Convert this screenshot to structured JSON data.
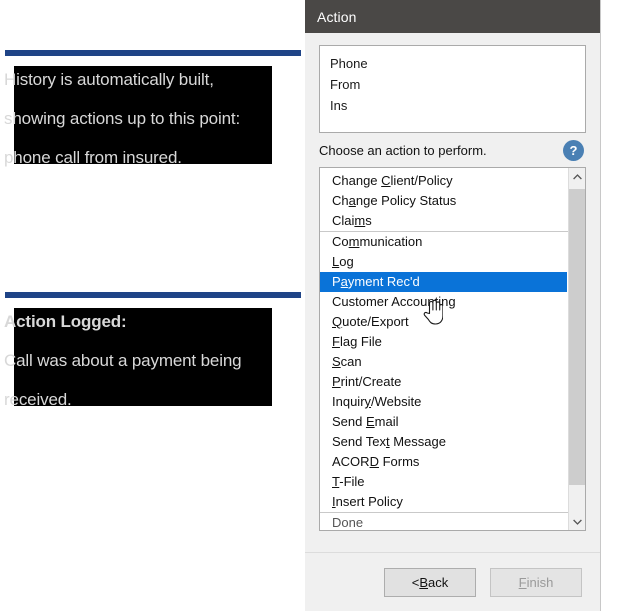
{
  "annotations": {
    "blocks": [
      {
        "lines": [
          {
            "text": "History is automatically built,",
            "bold": false
          },
          {
            "text": "showing actions up to this point:",
            "bold": false
          },
          {
            "text": "phone call from insured.",
            "bold": false
          }
        ]
      },
      {
        "lines": [
          {
            "text": "Action Logged:",
            "bold": true
          },
          {
            "text": "Call was about a payment being",
            "bold": false
          },
          {
            "text": "received.",
            "bold": false
          }
        ]
      }
    ],
    "rule_color": "#1f4487",
    "redaction_color": "#000000",
    "text_color": "#d8d8d8"
  },
  "dialog": {
    "title": "Action",
    "titlebar_color": "#4a4846",
    "history": {
      "lines": [
        "Phone",
        "From",
        "Ins"
      ]
    },
    "prompt": "Choose an action to perform.",
    "help_icon": "question-mark-circle-icon",
    "help_icon_color": "#4a80b4",
    "selection_color": "#0a73d8",
    "list": [
      {
        "label": "Change Client/Policy",
        "mnemonic": "C",
        "mnemonic_index": 7,
        "selected": false,
        "separator_after": false
      },
      {
        "label": "Change Policy Status",
        "mnemonic": "a",
        "mnemonic_index": 2,
        "selected": false,
        "separator_after": false
      },
      {
        "label": "Claims",
        "mnemonic": "m",
        "mnemonic_index": 4,
        "selected": false,
        "separator_after": true
      },
      {
        "label": "Communication",
        "mnemonic": "o",
        "mnemonic_index": 2,
        "selected": false,
        "separator_after": false
      },
      {
        "label": "Log",
        "mnemonic": "L",
        "mnemonic_index": 0,
        "selected": false,
        "separator_after": false
      },
      {
        "label": "Payment Rec'd",
        "mnemonic": "a",
        "mnemonic_index": 1,
        "selected": true,
        "separator_after": false
      },
      {
        "label": "Customer Accounting",
        "mnemonic": "n",
        "mnemonic_index": 15,
        "selected": false,
        "separator_after": false
      },
      {
        "label": "Quote/Export",
        "mnemonic": "Q",
        "mnemonic_index": 0,
        "selected": false,
        "separator_after": false
      },
      {
        "label": "Flag File",
        "mnemonic": "F",
        "mnemonic_index": 0,
        "selected": false,
        "separator_after": false
      },
      {
        "label": "Scan",
        "mnemonic": "S",
        "mnemonic_index": 0,
        "selected": false,
        "separator_after": false
      },
      {
        "label": "Print/Create",
        "mnemonic": "P",
        "mnemonic_index": 0,
        "selected": false,
        "separator_after": false
      },
      {
        "label": "Inquiry/Website",
        "mnemonic": "y",
        "mnemonic_index": 6,
        "selected": false,
        "separator_after": false
      },
      {
        "label": "Send Email",
        "mnemonic": "E",
        "mnemonic_index": 5,
        "selected": false,
        "separator_after": false
      },
      {
        "label": "Send Text Message",
        "mnemonic": "x",
        "mnemonic_index": 8,
        "selected": false,
        "separator_after": false
      },
      {
        "label": "ACORD Forms",
        "mnemonic": "D",
        "mnemonic_index": 4,
        "selected": false,
        "separator_after": false
      },
      {
        "label": "T-File",
        "mnemonic": "T",
        "mnemonic_index": 0,
        "selected": false,
        "separator_after": false
      },
      {
        "label": "Insert Policy",
        "mnemonic": "I",
        "mnemonic_index": 0,
        "selected": false,
        "separator_after": true
      },
      {
        "label": "Done",
        "mnemonic": "",
        "mnemonic_index": -1,
        "selected": false,
        "separator_after": false
      }
    ],
    "scrollbar": {
      "up_arrow": "chevron-up-icon",
      "down_arrow": "chevron-down-icon"
    },
    "buttons": {
      "back": {
        "label": "< Back",
        "mnemonic_index": 2,
        "disabled": false
      },
      "finish": {
        "label": "Finish",
        "mnemonic_index": 0,
        "disabled": true
      }
    }
  },
  "cursor": {
    "type": "hand-pointer-cursor"
  }
}
